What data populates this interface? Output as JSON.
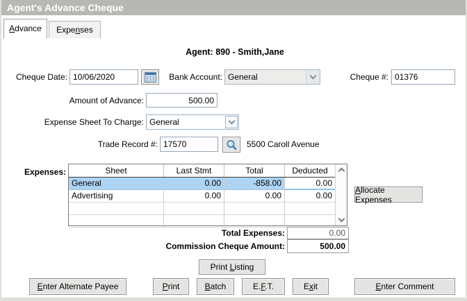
{
  "window": {
    "title": "Agent's Advance Cheque"
  },
  "tabs": {
    "advance": {
      "pre": "",
      "key": "A",
      "post": "dvance"
    },
    "expenses": {
      "pre": "Expe",
      "key": "n",
      "post": "ses"
    }
  },
  "agent_line": "Agent: 890 - Smith,Jane",
  "fields": {
    "cheque_date": {
      "label": "Cheque Date:",
      "value": "10/06/2020"
    },
    "bank_account": {
      "label": "Bank Account:",
      "value": "General"
    },
    "cheque_no": {
      "label": "Cheque #:",
      "value": "01376"
    },
    "amount_of_advance": {
      "label": "Amount of Advance:",
      "value": "500.00"
    },
    "expense_sheet": {
      "label": "Expense Sheet To Charge:",
      "value": "General"
    },
    "trade_record": {
      "label": "Trade Record #:",
      "value": "17570",
      "address": "5500 Caroll Avenue"
    }
  },
  "expenses_table": {
    "label": "Expenses:",
    "columns": [
      "Sheet",
      "Last Stmt",
      "Total",
      "Deducted"
    ],
    "rows": [
      {
        "sheet": "General",
        "last_stmt": "0.00",
        "total": "-858.00",
        "deducted": "0.00",
        "selected": true
      },
      {
        "sheet": "Advertising",
        "last_stmt": "0.00",
        "total": "0.00",
        "deducted": "0.00",
        "selected": false
      }
    ]
  },
  "totals": {
    "total_expenses_label": "Total Expenses:",
    "total_expenses_value": "0.00",
    "commission_label": "Commission Cheque Amount:",
    "commission_value": "500.00"
  },
  "buttons": {
    "allocate": {
      "pre": "",
      "key": "A",
      "post": "llocate Expenses"
    },
    "print_listing": {
      "pre": "Print ",
      "key": "L",
      "post": "isting"
    },
    "alt_payee": {
      "pre": "",
      "key": "E",
      "post": "nter Alternate Payee"
    },
    "print": {
      "pre": "",
      "key": "P",
      "post": "rint"
    },
    "batch": {
      "pre": "",
      "key": "B",
      "post": "atch"
    },
    "eft": {
      "pre": "E.",
      "key": "F",
      "post": ".T."
    },
    "exit": {
      "pre": "E",
      "key": "x",
      "post": "it"
    },
    "comment": {
      "pre": "",
      "key": "E",
      "post": "nter Comment"
    }
  },
  "colors": {
    "titlebar": "#b7b7b4",
    "row_selection": "#aed4f4",
    "icon_blue": "#3a75b0"
  }
}
